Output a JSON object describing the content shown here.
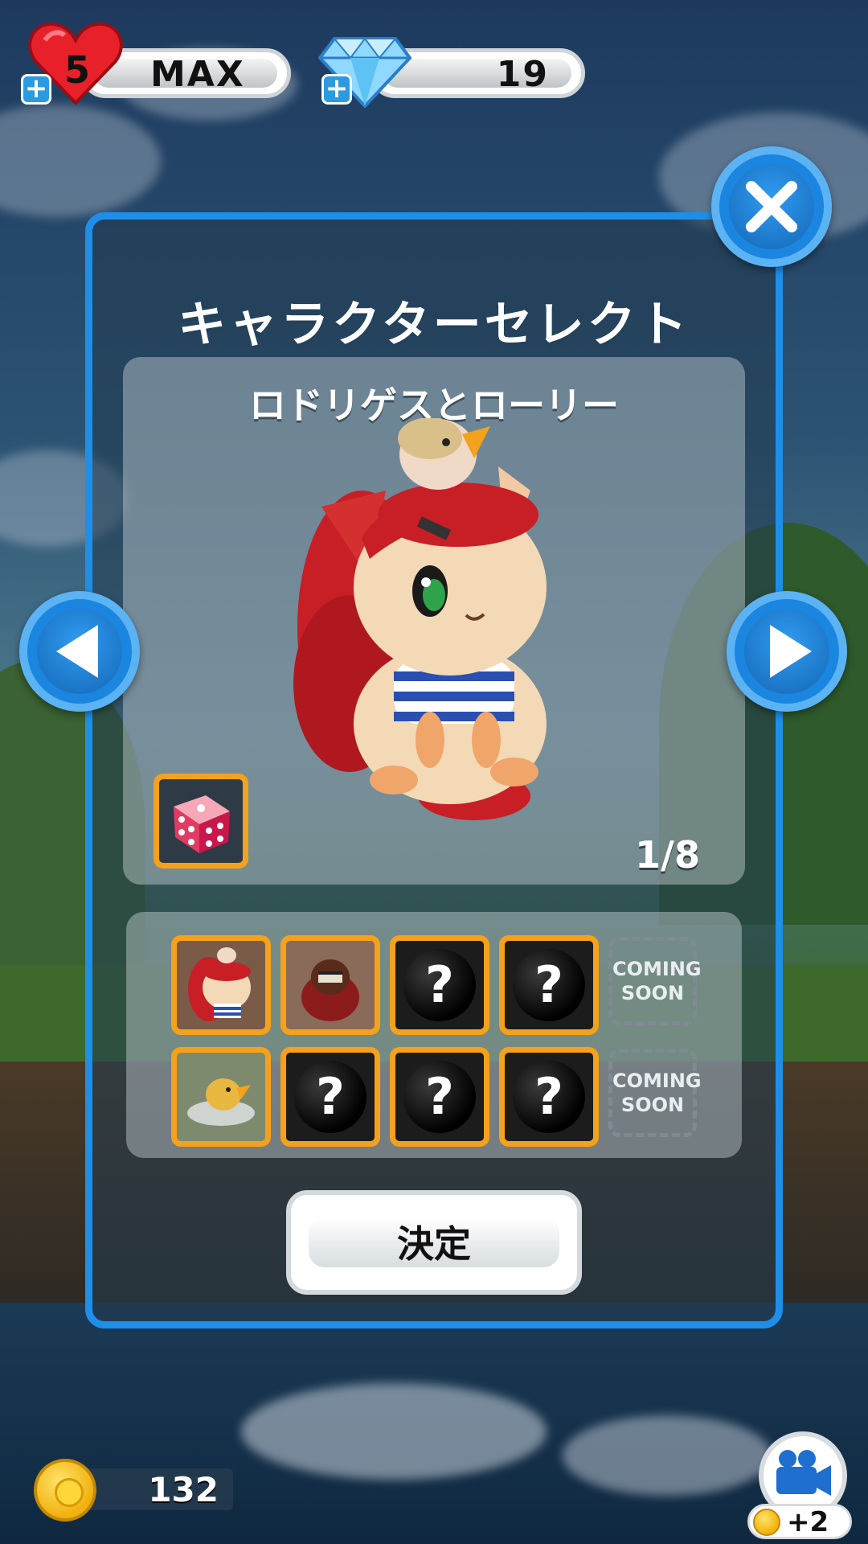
{
  "hud": {
    "lives_count": "5",
    "lives_status": "MAX",
    "gems_count": "19",
    "plus_symbol": "+"
  },
  "panel": {
    "title": "キャラクターセレクト",
    "character_name": "ロドリゲスとローリー",
    "page_counter": "1/8",
    "confirm_label": "決定",
    "coming_soon_top": "COMING",
    "coming_soon_bottom": "SOON",
    "locked_symbol": "?"
  },
  "footer": {
    "coins": "132",
    "video_reward": "+2"
  },
  "icons": {
    "close": "close-icon",
    "prev": "arrow-left-icon",
    "next": "arrow-right-icon",
    "dice": "dice-icon",
    "heart": "heart-icon",
    "gem": "diamond-icon",
    "coin": "coin-icon",
    "camera": "video-camera-icon"
  },
  "colors": {
    "panel_border": "#1e8fe8",
    "slot_border": "#f6a11b",
    "heart": "#e8202a",
    "gem": "#8fd8ff"
  }
}
